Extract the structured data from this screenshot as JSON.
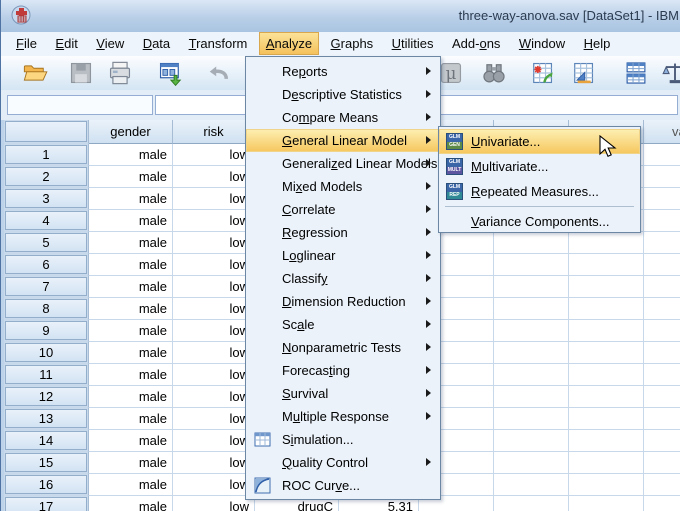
{
  "window": {
    "title": "three-way-anova.sav [DataSet1] - IBM"
  },
  "menubar": {
    "items": [
      {
        "label": "File",
        "accel": 0
      },
      {
        "label": "Edit",
        "accel": 0
      },
      {
        "label": "View",
        "accel": 0
      },
      {
        "label": "Data",
        "accel": 0
      },
      {
        "label": "Transform",
        "accel": 0
      },
      {
        "label": "Analyze",
        "accel": 0
      },
      {
        "label": "Graphs",
        "accel": 0
      },
      {
        "label": "Utilities",
        "accel": 0
      },
      {
        "label": "Add-ons",
        "accel": 4
      },
      {
        "label": "Window",
        "accel": 0
      },
      {
        "label": "Help",
        "accel": 0
      }
    ]
  },
  "toolbar": {
    "buttons": [
      {
        "icon": "open-file",
        "disabled": false
      },
      {
        "icon": "save-file",
        "disabled": true
      },
      {
        "icon": "print",
        "disabled": false
      },
      {
        "icon": "recall-dialogs",
        "disabled": false
      },
      {
        "icon": "undo",
        "disabled": true
      },
      {
        "icon": "variables-mu",
        "disabled": true
      },
      {
        "icon": "find",
        "disabled": true
      },
      {
        "icon": "insert-cases",
        "disabled": false
      },
      {
        "icon": "insert-variable",
        "disabled": false
      },
      {
        "icon": "split-file",
        "disabled": false
      },
      {
        "icon": "weight-cases",
        "disabled": false
      }
    ]
  },
  "cell_editor": {
    "reference": "",
    "value": ""
  },
  "analyze_menu": {
    "items": [
      {
        "label": "Reports",
        "accel": 2,
        "submenu": true
      },
      {
        "label": "Descriptive Statistics",
        "accel": 1,
        "submenu": true
      },
      {
        "label": "Compare Means",
        "accel": 2,
        "submenu": true
      },
      {
        "label": "General Linear Model",
        "accel": 0,
        "submenu": true,
        "highlighted": true
      },
      {
        "label": "Generalized Linear Models",
        "accel": 8,
        "submenu": true
      },
      {
        "label": "Mixed Models",
        "accel": 2,
        "submenu": true
      },
      {
        "label": "Correlate",
        "accel": 0,
        "submenu": true
      },
      {
        "label": "Regression",
        "accel": 0,
        "submenu": true
      },
      {
        "label": "Loglinear",
        "accel": 1,
        "submenu": true
      },
      {
        "label": "Classify",
        "accel": 7,
        "submenu": true
      },
      {
        "label": "Dimension Reduction",
        "accel": 0,
        "submenu": true
      },
      {
        "label": "Scale",
        "accel": 2,
        "submenu": true
      },
      {
        "label": "Nonparametric Tests",
        "accel": 0,
        "submenu": true
      },
      {
        "label": "Forecasting",
        "accel": 7,
        "submenu": true
      },
      {
        "label": "Survival",
        "accel": 0,
        "submenu": true
      },
      {
        "label": "Multiple Response",
        "accel": 1,
        "submenu": true
      },
      {
        "label": "Simulation...",
        "accel": 1,
        "submenu": false,
        "icon": "simulation-grid"
      },
      {
        "label": "Quality Control",
        "accel": 0,
        "submenu": true
      },
      {
        "label": "ROC Curve...",
        "accel": 7,
        "submenu": false,
        "icon": "roc-curve"
      }
    ]
  },
  "glm_submenu": {
    "items": [
      {
        "label": "Univariate...",
        "accel": 0,
        "icon_text": [
          "GLM",
          "GEN"
        ],
        "highlighted": true
      },
      {
        "label": "Multivariate...",
        "accel": 0,
        "icon_text": [
          "GLM",
          "MULT"
        ]
      },
      {
        "label": "Repeated Measures...",
        "accel": 0,
        "icon_text": [
          "GLM",
          "REP"
        ]
      },
      {
        "label": "Variance Components...",
        "accel": 0
      }
    ]
  },
  "grid": {
    "columns": [
      "",
      "gender",
      "risk",
      "",
      "",
      "",
      "",
      "",
      "var"
    ],
    "rows": [
      {
        "n": "1",
        "gender": "male",
        "risk": "low",
        "drug": "",
        "value": ""
      },
      {
        "n": "2",
        "gender": "male",
        "risk": "low",
        "drug": "",
        "value": ""
      },
      {
        "n": "3",
        "gender": "male",
        "risk": "low",
        "drug": "",
        "value": ""
      },
      {
        "n": "4",
        "gender": "male",
        "risk": "low",
        "drug": "",
        "value": ""
      },
      {
        "n": "5",
        "gender": "male",
        "risk": "low",
        "drug": "",
        "value": ""
      },
      {
        "n": "6",
        "gender": "male",
        "risk": "low",
        "drug": "",
        "value": ""
      },
      {
        "n": "7",
        "gender": "male",
        "risk": "low",
        "drug": "",
        "value": ""
      },
      {
        "n": "8",
        "gender": "male",
        "risk": "low",
        "drug": "",
        "value": ""
      },
      {
        "n": "9",
        "gender": "male",
        "risk": "low",
        "drug": "",
        "value": ""
      },
      {
        "n": "10",
        "gender": "male",
        "risk": "low",
        "drug": "",
        "value": ""
      },
      {
        "n": "11",
        "gender": "male",
        "risk": "low",
        "drug": "",
        "value": ""
      },
      {
        "n": "12",
        "gender": "male",
        "risk": "low",
        "drug": "",
        "value": ""
      },
      {
        "n": "13",
        "gender": "male",
        "risk": "low",
        "drug": "",
        "value": ""
      },
      {
        "n": "14",
        "gender": "male",
        "risk": "low",
        "drug": "",
        "value": ""
      },
      {
        "n": "15",
        "gender": "male",
        "risk": "low",
        "drug": "",
        "value": ""
      },
      {
        "n": "16",
        "gender": "male",
        "risk": "low",
        "drug": "",
        "value": ""
      },
      {
        "n": "17",
        "gender": "male",
        "risk": "low",
        "drug": "drugC",
        "value": "5.31"
      }
    ]
  }
}
